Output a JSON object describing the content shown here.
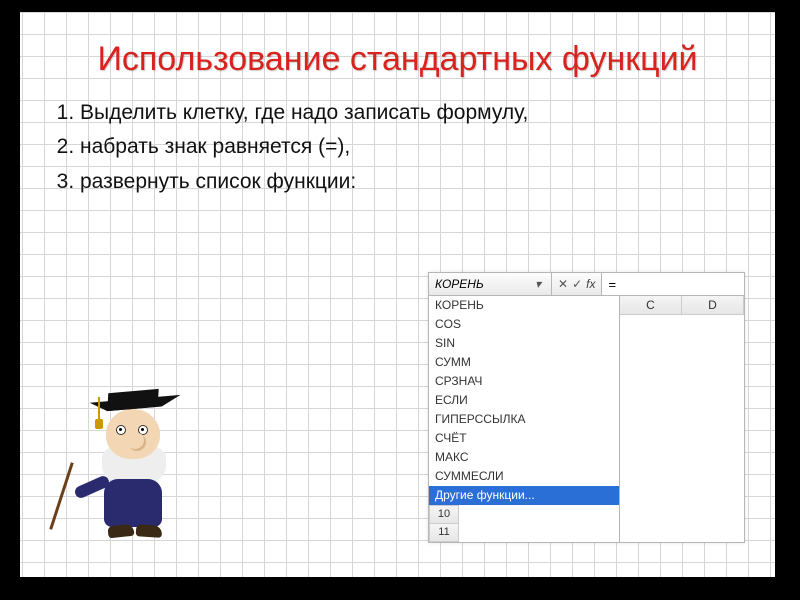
{
  "title": "Использование стандартных функций",
  "steps": [
    "Выделить клетку, где надо записать формулу,",
    "набрать знак равняется (=),",
    "развернуть список функции:"
  ],
  "excel": {
    "namebox": "КОРЕНЬ",
    "formula": "=",
    "fx_label": "fx",
    "cancel": "✕",
    "accept": "✓",
    "columns": [
      "C",
      "D"
    ],
    "bottom_rows": [
      "10",
      "11"
    ],
    "functions": [
      "КОРЕНЬ",
      "COS",
      "SIN",
      "СУММ",
      "СРЗНАЧ",
      "ЕСЛИ",
      "ГИПЕРССЫЛКА",
      "СЧЁТ",
      "МАКС",
      "СУММЕСЛИ",
      "Другие функции..."
    ],
    "selected_index": 10
  }
}
